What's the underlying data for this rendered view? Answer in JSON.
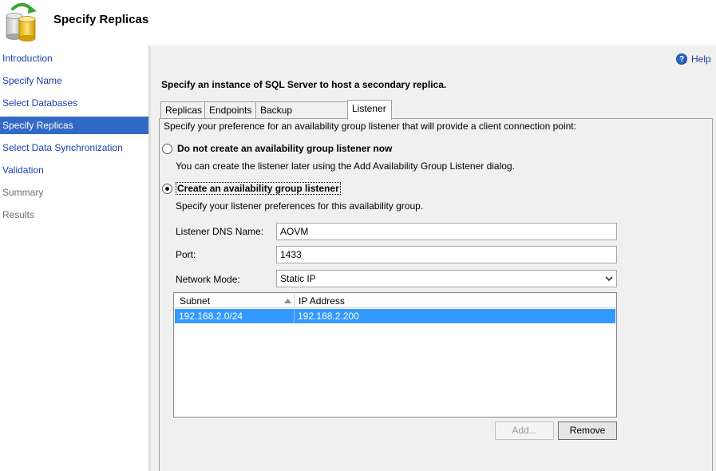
{
  "header": {
    "title": "Specify Replicas",
    "icon": "database-sync-icon"
  },
  "sidebar": {
    "items": [
      {
        "label": "Introduction",
        "state": "link"
      },
      {
        "label": "Specify Name",
        "state": "link"
      },
      {
        "label": "Select Databases",
        "state": "link"
      },
      {
        "label": "Specify Replicas",
        "state": "active"
      },
      {
        "label": "Select Data Synchronization",
        "state": "link"
      },
      {
        "label": "Validation",
        "state": "link"
      },
      {
        "label": "Summary",
        "state": "disabled"
      },
      {
        "label": "Results",
        "state": "disabled"
      }
    ]
  },
  "help": {
    "label": "Help",
    "icon": "help-icon"
  },
  "main": {
    "title": "Specify an instance of SQL Server to host a secondary replica.",
    "tabs": [
      {
        "label": "Replicas",
        "active": false
      },
      {
        "label": "Endpoints",
        "active": false
      },
      {
        "label": "Backup Preferences",
        "active": false
      },
      {
        "label": "Listener",
        "active": true
      }
    ],
    "listener": {
      "description": "Specify your preference for an availability group listener that will provide a client connection point:",
      "option_no_listener": {
        "label": "Do not create an availability group listener now",
        "hint": "You can create the listener later using the Add Availability Group Listener dialog.",
        "selected": false
      },
      "option_create": {
        "label": "Create an availability group listener",
        "hint": "Specify your listener preferences for this availability group.",
        "selected": true
      },
      "dns_name": {
        "label": "Listener DNS Name:",
        "value": "AOVM"
      },
      "port": {
        "label": "Port:",
        "value": "1433"
      },
      "network_mode": {
        "label": "Network Mode:",
        "value": "Static IP"
      },
      "grid": {
        "columns": [
          "Subnet",
          "IP Address"
        ],
        "rows": [
          {
            "subnet": "192.168.2.0/24",
            "ip": "192.168.2.200",
            "selected": true
          }
        ]
      },
      "buttons": {
        "add": "Add...",
        "remove": "Remove"
      }
    }
  },
  "colors": {
    "accent": "#3169c6",
    "link": "#1b3fa8",
    "row_selected": "#3399ff"
  }
}
